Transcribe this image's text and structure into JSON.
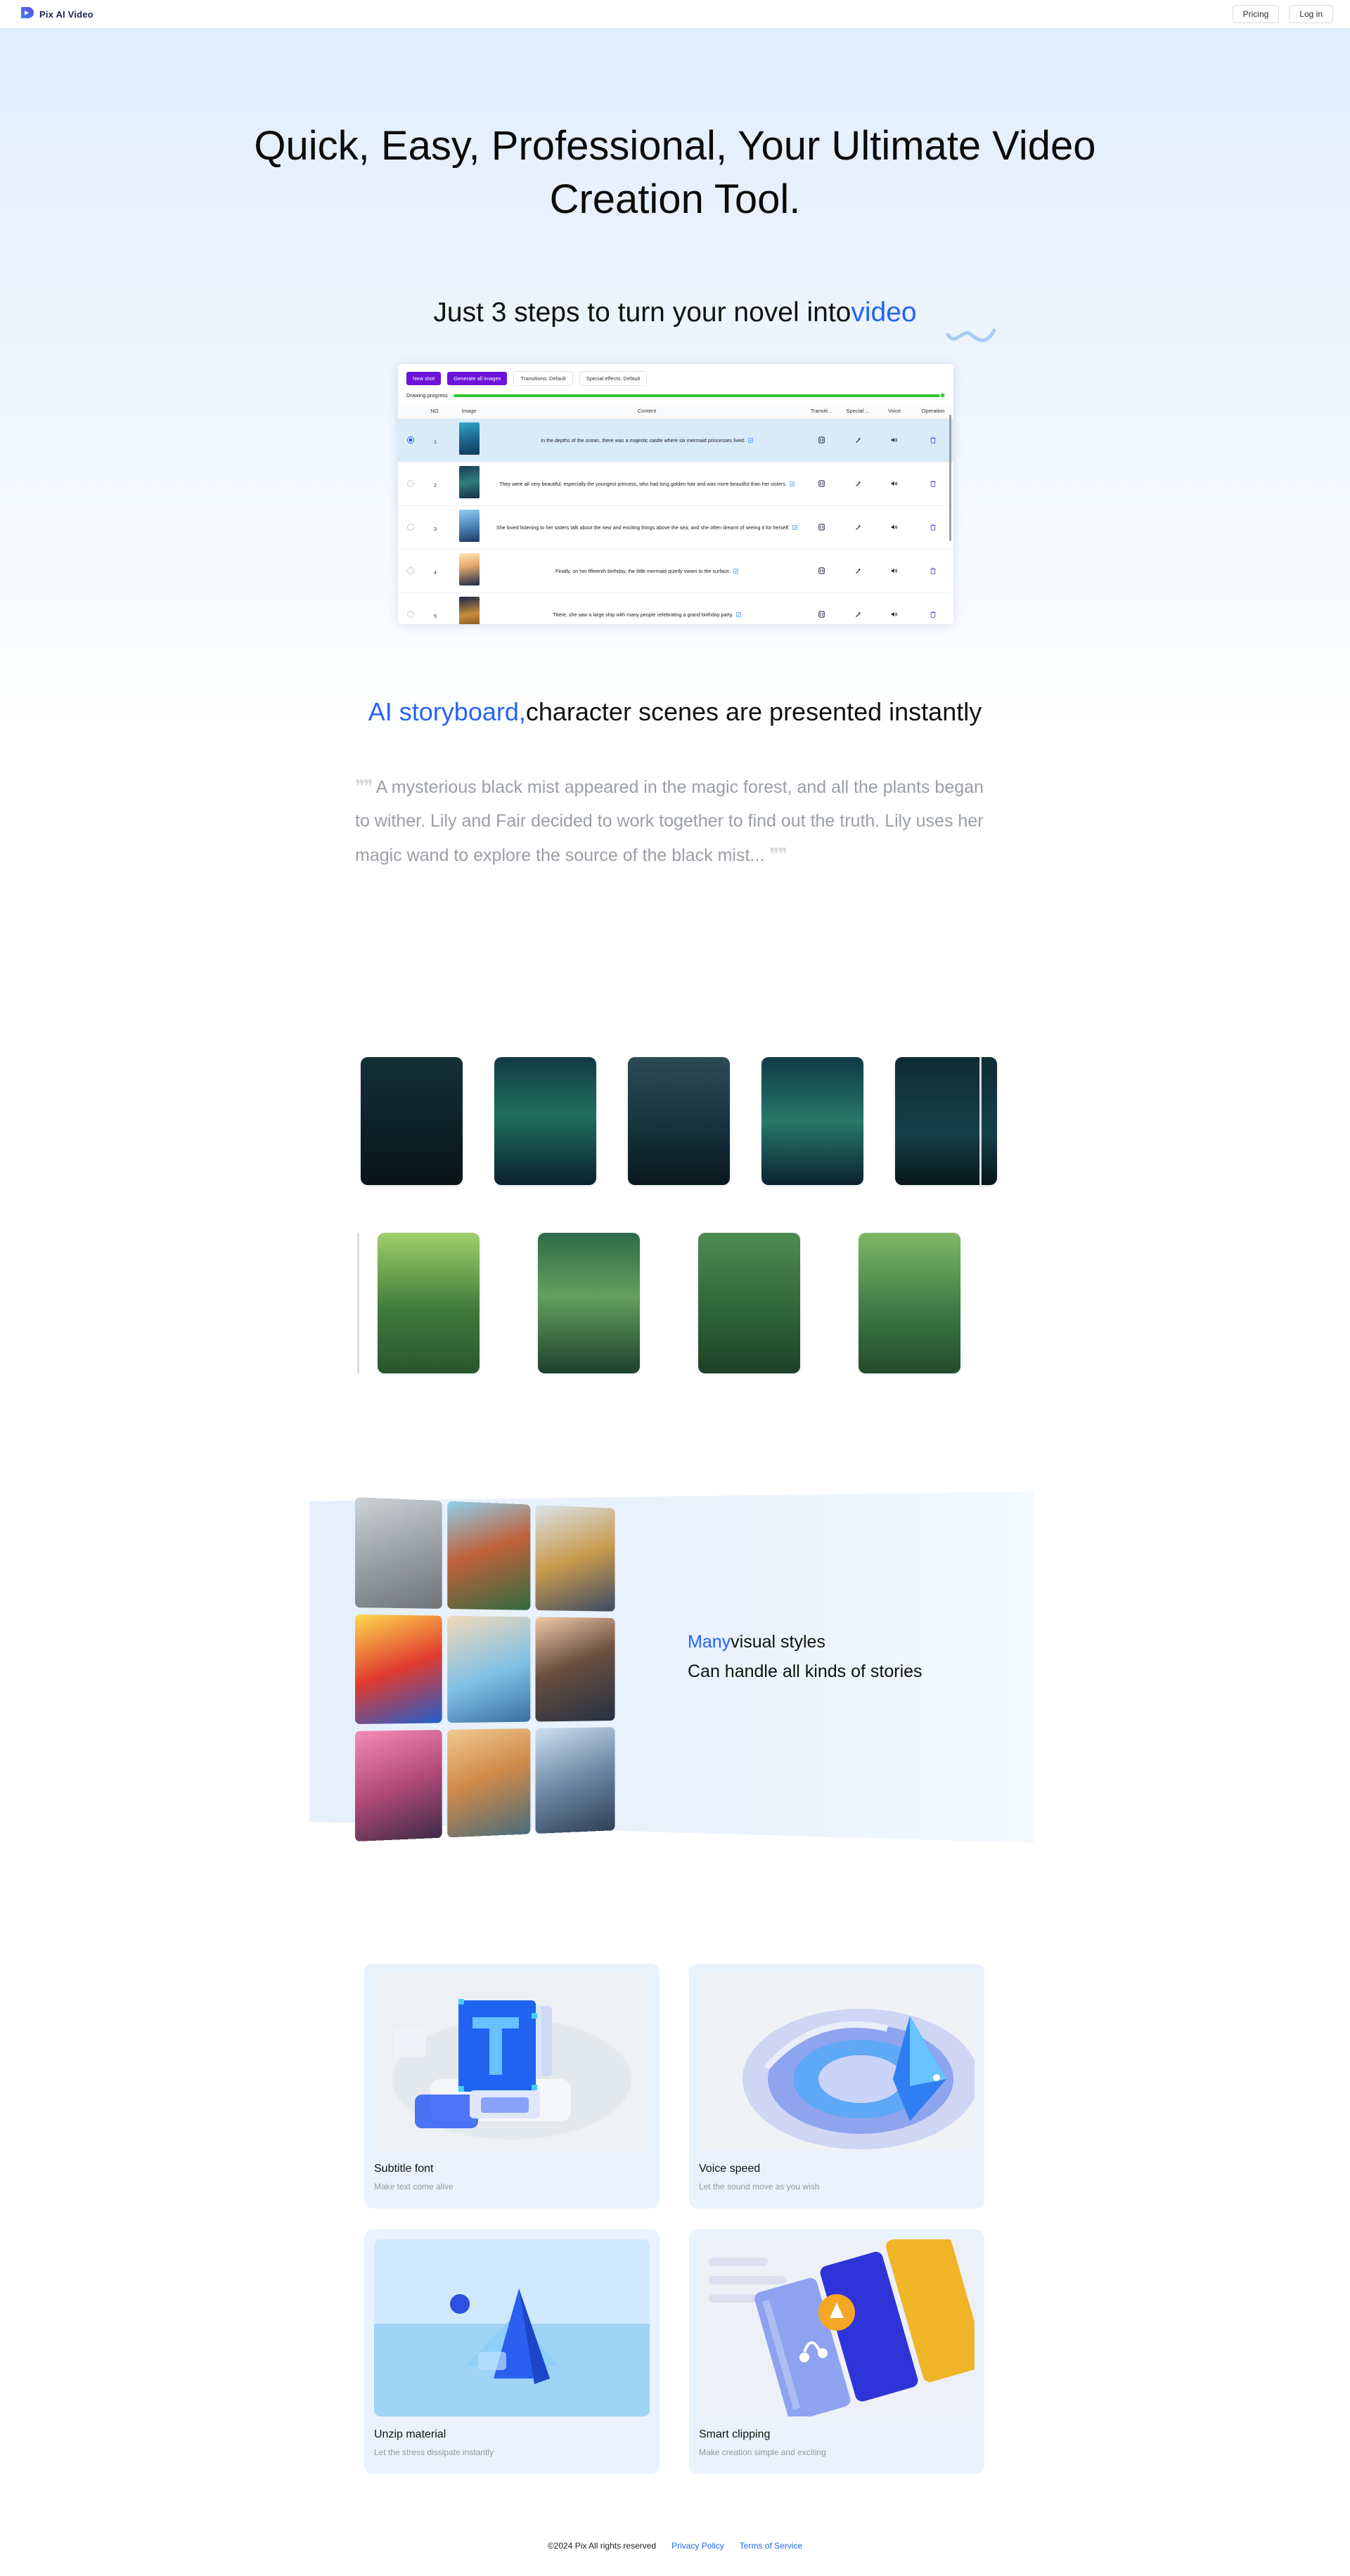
{
  "header": {
    "brand": "Pix AI Video",
    "logo_icon": "play-logo-icon",
    "pricing_label": "Pricing",
    "login_label": "Log in"
  },
  "hero": {
    "title": "Quick, Easy, Professional, Your Ultimate Video Creation Tool.",
    "subtitle_plain": "Just 3 steps to turn your novel into",
    "subtitle_accent": "video",
    "accent_color": "#2563f6"
  },
  "app_screenshot": {
    "buttons": [
      {
        "label": "New shot",
        "style": "primary"
      },
      {
        "label": "Generate all images",
        "style": "primary"
      },
      {
        "label": "Transitions: Default",
        "style": "ghost"
      },
      {
        "label": "Special effects: Default",
        "style": "ghost"
      }
    ],
    "progress": {
      "label": "Drawing progress",
      "percent": 100,
      "color": "#2ec42e"
    },
    "columns": [
      "",
      "NO.",
      "Image",
      "Content",
      "Transiti...",
      "Special ...",
      "Voice",
      "Operation"
    ],
    "rows": [
      {
        "no": "1",
        "selected": true,
        "content": "In the depths of the ocean, there was a majestic castle where six mermaid princesses lived.",
        "transition_icon": "transition-icon",
        "effect_icon": "magic-wand-icon",
        "voice_icon": "speaker-icon",
        "operation_icon": "trash-icon"
      },
      {
        "no": "2",
        "selected": false,
        "content": "They were all very beautiful, especially the youngest princess, who had long golden hair and was more beautiful than her sisters.",
        "transition_icon": "transition-icon",
        "effect_icon": "magic-wand-icon",
        "voice_icon": "speaker-icon",
        "operation_icon": "trash-icon"
      },
      {
        "no": "3",
        "selected": false,
        "content": "She loved listening to her sisters talk about the new and exciting things above the sea, and she often dreamt of seeing it for herself.",
        "transition_icon": "transition-icon",
        "effect_icon": "magic-wand-icon",
        "voice_icon": "speaker-icon",
        "operation_icon": "trash-icon"
      },
      {
        "no": "4",
        "selected": false,
        "content": "Finally, on her fifteenth birthday, the little mermaid quietly swam to the surface.",
        "transition_icon": "transition-icon",
        "effect_icon": "magic-wand-icon",
        "voice_icon": "speaker-icon",
        "operation_icon": "trash-icon"
      },
      {
        "no": "5",
        "selected": false,
        "content": "There, she saw a large ship with many people celebrating a grand birthday party.",
        "transition_icon": "transition-icon",
        "effect_icon": "magic-wand-icon",
        "voice_icon": "speaker-icon",
        "operation_icon": "trash-icon"
      }
    ]
  },
  "storyboard": {
    "heading_accent": "AI storyboard,",
    "heading_plain": "character scenes are presented instantly",
    "quote_open": "“",
    "quote_close": "”",
    "quote_text": "A mysterious black mist appeared in the magic forest, and all the plants began to wither. Lily and Fair decided to work together to find out the truth. Lily uses her magic wand to explore the source of the black mist..."
  },
  "styles": {
    "title_accent": "Many",
    "title_plain": "visual styles",
    "subtitle": "Can handle all kinds of stories"
  },
  "features": [
    {
      "title": "Subtitle font",
      "subtitle": "Make text come alive"
    },
    {
      "title": "Voice speed",
      "subtitle": "Let the sound move as you wish"
    },
    {
      "title": "Unzip material",
      "subtitle": "Let the stress dissipate instantly"
    },
    {
      "title": "Smart clipping",
      "subtitle": "Make creation simple and exciting"
    }
  ],
  "footer": {
    "copyright": "©2024 Pix All rights reserved",
    "privacy": "Privacy Policy",
    "terms": "Terms of Service"
  }
}
